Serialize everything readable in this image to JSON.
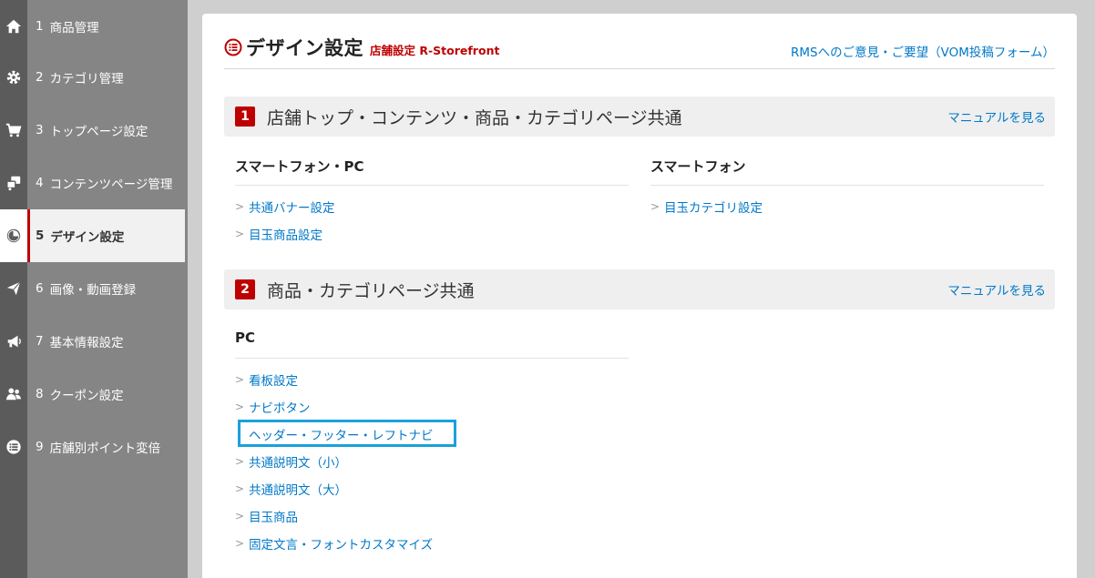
{
  "sidebar": {
    "items": [
      {
        "num": "1",
        "label": "商品管理",
        "icon": "home-icon"
      },
      {
        "num": "2",
        "label": "カテゴリ管理",
        "icon": "gear-icon"
      },
      {
        "num": "3",
        "label": "トップページ設定",
        "icon": "cart-icon"
      },
      {
        "num": "4",
        "label": "コンテンツページ管理",
        "icon": "pages-icon"
      },
      {
        "num": "5",
        "label": "デザイン設定",
        "icon": "pie-chart-icon",
        "active": true
      },
      {
        "num": "6",
        "label": "画像・動画登録",
        "icon": "paper-plane-icon"
      },
      {
        "num": "7",
        "label": "基本情報設定",
        "icon": "megaphone-icon"
      },
      {
        "num": "8",
        "label": "クーポン設定",
        "icon": "users-icon"
      },
      {
        "num": "9",
        "label": "店舗別ポイント変倍",
        "icon": "list-icon"
      }
    ]
  },
  "header": {
    "title": "デザイン設定",
    "subtitle": "店舗設定 R-Storefront",
    "feedback_link": "RMSへのご意見・ご要望（VOM投稿フォーム）"
  },
  "sections": [
    {
      "num": "1",
      "title": "店舗トップ・コンテンツ・商品・カテゴリページ共通",
      "manual_link": "マニュアルを見る",
      "columns": [
        {
          "heading": "スマートフォン・PC",
          "links": [
            "共通バナー設定",
            "目玉商品設定"
          ]
        },
        {
          "heading": "スマートフォン",
          "links": [
            "目玉カテゴリ設定"
          ]
        }
      ]
    },
    {
      "num": "2",
      "title": "商品・カテゴリページ共通",
      "manual_link": "マニュアルを見る",
      "columns": [
        {
          "heading": "PC",
          "links": [
            "看板設定",
            "ナビボタン",
            "ヘッダー・フッター・レフトナビ",
            "共通説明文（小）",
            "共通説明文（大）",
            "目玉商品",
            "固定文言・フォントカスタマイズ"
          ]
        }
      ]
    }
  ],
  "colors": {
    "accent": "#bf0000",
    "link": "#0078c8",
    "highlight": "#1aa0dc"
  }
}
